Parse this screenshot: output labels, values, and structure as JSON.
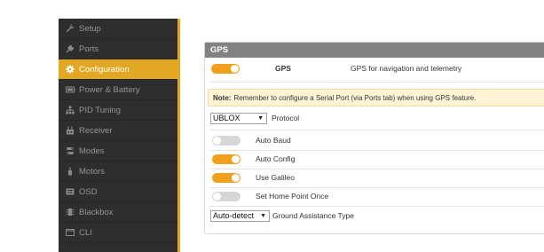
{
  "sidebar": {
    "items": [
      {
        "label": "Setup",
        "icon": "wrench-icon",
        "active": false
      },
      {
        "label": "Ports",
        "icon": "plug-icon",
        "active": false
      },
      {
        "label": "Configuration",
        "icon": "gear-icon",
        "active": true
      },
      {
        "label": "Power & Battery",
        "icon": "battery-icon",
        "active": false
      },
      {
        "label": "PID Tuning",
        "icon": "sitemap-icon",
        "active": false
      },
      {
        "label": "Receiver",
        "icon": "receiver-icon",
        "active": false
      },
      {
        "label": "Modes",
        "icon": "modes-icon",
        "active": false
      },
      {
        "label": "Motors",
        "icon": "motor-icon",
        "active": false
      },
      {
        "label": "OSD",
        "icon": "osd-icon",
        "active": false
      },
      {
        "label": "Blackbox",
        "icon": "blackbox-icon",
        "active": false
      },
      {
        "label": "CLI",
        "icon": "terminal-icon",
        "active": false
      }
    ]
  },
  "gps_panel": {
    "title": "GPS",
    "gps_toggle": {
      "label": "GPS",
      "description": "GPS for navigation and telemetry",
      "on": true
    },
    "note": {
      "prefix": "Note:",
      "text": "Remember to configure a Serial Port (via Ports tab) when using GPS feature."
    },
    "protocol": {
      "value": "UBLOX",
      "label": "Protocol"
    },
    "auto_baud": {
      "label": "Auto Baud",
      "on": false
    },
    "auto_config": {
      "label": "Auto Config",
      "on": true
    },
    "use_galileo": {
      "label": "Use Galileo",
      "on": true
    },
    "set_home_point_once": {
      "label": "Set Home Point Once",
      "on": false
    },
    "ground_assistance": {
      "value": "Auto-detect",
      "label": "Ground Assistance Type"
    }
  },
  "colors": {
    "accent": "#e2a823",
    "toggle_on": "#f0a01c",
    "toggle_off": "#d6d6d6",
    "sidebar_bg": "#2e2e2e",
    "note_bg": "#fff5d6"
  }
}
